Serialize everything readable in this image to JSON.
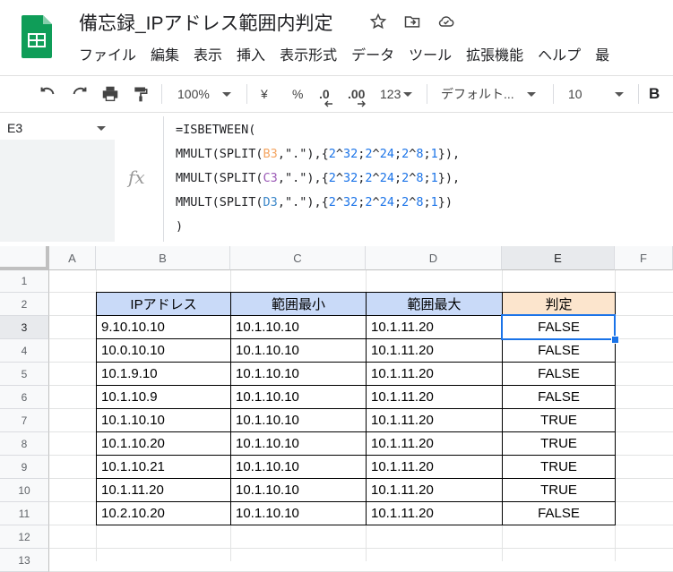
{
  "title": "備忘録_IPアドレス範囲内判定",
  "menu": [
    "ファイル",
    "編集",
    "表示",
    "挿入",
    "表示形式",
    "データ",
    "ツール",
    "拡張機能",
    "ヘルプ",
    "最"
  ],
  "toolbar": {
    "zoom": "100%",
    "currency": "¥",
    "percent": "%",
    "dec_decrease": ".0",
    "dec_increase": ".00",
    "format_more": "123",
    "font": "デフォルト...",
    "font_size": "10",
    "bold": "B"
  },
  "name_box": "E3",
  "formula_lines": [
    "=ISBETWEEN(",
    "MMULT(SPLIT(B3,\".\"),{2^32;2^24;2^8;1}),",
    "MMULT(SPLIT(C3,\".\"),{2^32;2^24;2^8;1}),",
    "MMULT(SPLIT(D3,\".\"),{2^32;2^24;2^8;1})",
    ")"
  ],
  "fx_label": "fx",
  "columns": [
    "A",
    "B",
    "C",
    "D",
    "E",
    "F"
  ],
  "rows": [
    "1",
    "2",
    "3",
    "4",
    "5",
    "6",
    "7",
    "8",
    "9",
    "10",
    "11",
    "12",
    "13"
  ],
  "table": {
    "headers": [
      "IPアドレス",
      "範囲最小",
      "範囲最大",
      "判定"
    ],
    "rows": [
      [
        "9.10.10.10",
        "10.1.10.10",
        "10.1.11.20",
        "FALSE"
      ],
      [
        "10.0.10.10",
        "10.1.10.10",
        "10.1.11.20",
        "FALSE"
      ],
      [
        "10.1.9.10",
        "10.1.10.10",
        "10.1.11.20",
        "FALSE"
      ],
      [
        "10.1.10.9",
        "10.1.10.10",
        "10.1.11.20",
        "FALSE"
      ],
      [
        "10.1.10.10",
        "10.1.10.10",
        "10.1.11.20",
        "TRUE"
      ],
      [
        "10.1.10.20",
        "10.1.10.10",
        "10.1.11.20",
        "TRUE"
      ],
      [
        "10.1.10.21",
        "10.1.10.10",
        "10.1.11.20",
        "TRUE"
      ],
      [
        "10.1.11.20",
        "10.1.10.10",
        "10.1.11.20",
        "TRUE"
      ],
      [
        "10.2.10.20",
        "10.1.10.10",
        "10.1.11.20",
        "FALSE"
      ]
    ]
  },
  "colors": {
    "header_blue": "#c9daf8",
    "header_orange": "#fce5cd",
    "selection": "#1a73e8",
    "sheets_green": "#0f9d58"
  }
}
